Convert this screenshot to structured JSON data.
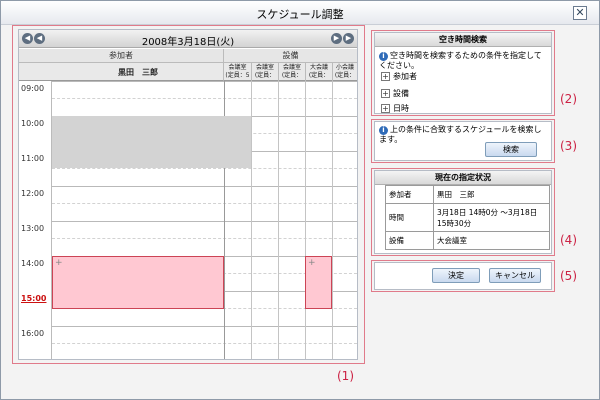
{
  "window": {
    "title": "スケジュール調整",
    "close": "✕"
  },
  "calendar": {
    "date": "2008年3月18日(火)",
    "prev_icon": "◀",
    "next_icon": "▶",
    "group_participants": "参加者",
    "group_equipment": "設備",
    "participant": "黒田　三郎",
    "rooms": [
      {
        "name": "会議室",
        "cap": "(定員：5"
      },
      {
        "name": "会議室",
        "cap": "(定員："
      },
      {
        "name": "会議室",
        "cap": "(定員："
      },
      {
        "name": "大会議",
        "cap": "(定員："
      },
      {
        "name": "小会議",
        "cap": "(定員："
      }
    ],
    "times": [
      "09:00",
      "10:00",
      "11:00",
      "12:00",
      "13:00",
      "14:00",
      "15:00",
      "16:00"
    ],
    "highlight_time": "15:00",
    "add_icon": "+"
  },
  "search_panel": {
    "title": "空き時間検索",
    "description": "空き時間を検索するための条件を指定してください。",
    "conditions": [
      "参加者",
      "設備",
      "日時"
    ],
    "note": "上の条件に合致するスケジュールを検索します。",
    "search_button": "検索"
  },
  "status_panel": {
    "title": "現在の指定状況",
    "rows": [
      {
        "key": "参加者",
        "value": "黒田　三郎"
      },
      {
        "key": "時間",
        "value": "3月18日 14時0分 〜3月18日 15時30分"
      },
      {
        "key": "設備",
        "value": "大会議室"
      }
    ]
  },
  "actions": {
    "ok": "決定",
    "cancel": "キャンセル"
  },
  "region_labels": [
    "(1)",
    "(2)",
    "(3)",
    "(4)",
    "(5)"
  ]
}
